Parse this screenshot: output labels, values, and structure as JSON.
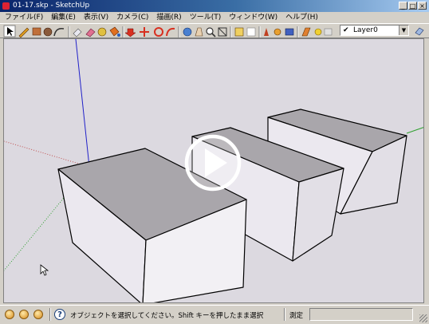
{
  "window": {
    "title": "01-17.skp - SketchUp",
    "controls": [
      "_",
      "□",
      "×"
    ]
  },
  "menu": [
    "ファイル(F)",
    "編集(E)",
    "表示(V)",
    "カメラ(C)",
    "描画(R)",
    "ツール(T)",
    "ウィンドウ(W)",
    "ヘルプ(H)"
  ],
  "toolbar": {
    "tools": [
      "select-icon",
      "pencil-icon",
      "rectangle-icon",
      "circle-icon",
      "arc-icon",
      "push-pull-icon",
      "eraser-icon",
      "paint-bucket-icon",
      "tape-measure-icon",
      "move-icon",
      "rotate-icon",
      "follow-me-icon",
      "offset-icon",
      "orbit-icon",
      "pan-icon",
      "zoom-icon",
      "zoom-extents-icon",
      "components-icon",
      "section-icon",
      "walk-icon",
      "look-around-icon",
      "camera-icon",
      "shadow-icon",
      "x-ray-icon",
      "layers-icon"
    ],
    "layer_check": "✔",
    "layer": "Layer0"
  },
  "viewport": {
    "bg": "#dcd9e0",
    "play_button": "play-icon"
  },
  "status": {
    "message": "オブジェクトを選択してください。Shift キーを押したまま選択",
    "measure_label": "測定",
    "help": "?"
  }
}
